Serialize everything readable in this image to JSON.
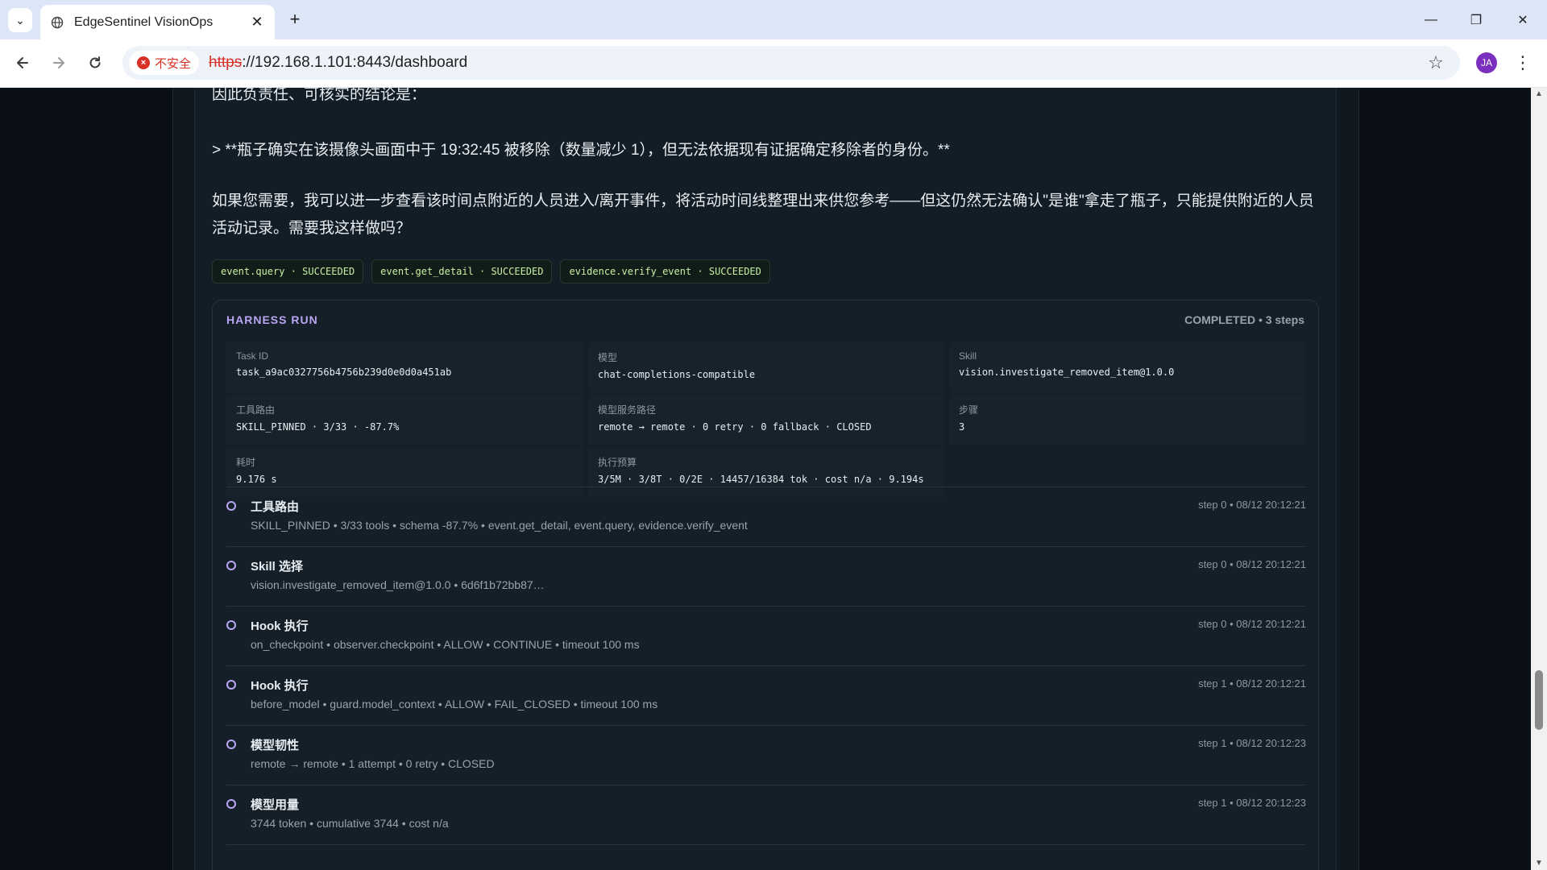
{
  "browser": {
    "tab_title": "EdgeSentinel VisionOps",
    "security_label": "不安全",
    "url_scheme": "https",
    "url_rest": "://192.168.1.101:8443/dashboard",
    "profile_initials": "JA",
    "scroll_position": 0.82,
    "scroll_visible_fraction": 0.08
  },
  "message": {
    "partial_line": "因此负责任、可核实的结论是：",
    "quote": "> **瓶子确实在该摄像头画面中于 19:32:45 被移除（数量减少 1），但无法依据现有证据确定移除者的身份。**",
    "followup": "如果您需要，我可以进一步查看该时间点附近的人员进入/离开事件，将活动时间线整理出来供您参考——但这仍然无法确认\"是谁\"拿走了瓶子，只能提供附近的人员活动记录。需要我这样做吗？"
  },
  "tool_calls": [
    {
      "label": "event.query · SUCCEEDED"
    },
    {
      "label": "event.get_detail · SUCCEEDED"
    },
    {
      "label": "evidence.verify_event · SUCCEEDED"
    }
  ],
  "harness": {
    "title": "HARNESS RUN",
    "status": "COMPLETED • 3 steps",
    "meta": [
      {
        "label": "Task ID",
        "value": "task_a9ac0327756b4756b239d0e0d0a451ab"
      },
      {
        "label": "模型",
        "value": "chat-completions-compatible"
      },
      {
        "label": "Skill",
        "value": "vision.investigate_removed_item@1.0.0"
      },
      {
        "label": "工具路由",
        "value": "SKILL_PINNED · 3/33 · -87.7%"
      },
      {
        "label": "模型服务路径",
        "value": "remote → remote · 0 retry · 0 fallback · CLOSED"
      },
      {
        "label": "步骤",
        "value": "3"
      },
      {
        "label": "耗时",
        "value": "9.176 s"
      },
      {
        "label": "执行预算",
        "value": "3/5M · 3/8T · 0/2E · 14457/16384 tok · cost n/a · 9.194s"
      }
    ],
    "steps": [
      {
        "title": "工具路由",
        "detail": "SKILL_PINNED • 3/33 tools • schema -87.7% • event.get_detail, event.query, evidence.verify_event",
        "meta": "step 0 • 08/12 20:12:21"
      },
      {
        "title": "Skill 选择",
        "detail": "vision.investigate_removed_item@1.0.0 • 6d6f1b72bb87…",
        "meta": "step 0 • 08/12 20:12:21"
      },
      {
        "title": "Hook 执行",
        "detail": "on_checkpoint • observer.checkpoint • ALLOW • CONTINUE • timeout 100 ms",
        "meta": "step 0 • 08/12 20:12:21"
      },
      {
        "title": "Hook 执行",
        "detail": "before_model • guard.model_context • ALLOW • FAIL_CLOSED • timeout 100 ms",
        "meta": "step 1 • 08/12 20:12:21"
      },
      {
        "title": "模型韧性",
        "detail": "remote → remote • 1 attempt • 0 retry • CLOSED",
        "meta": "step 1 • 08/12 20:12:23"
      },
      {
        "title": "模型用量",
        "detail": "3744 token • cumulative 3744 • cost n/a",
        "meta": "step 1 • 08/12 20:12:23"
      }
    ]
  }
}
